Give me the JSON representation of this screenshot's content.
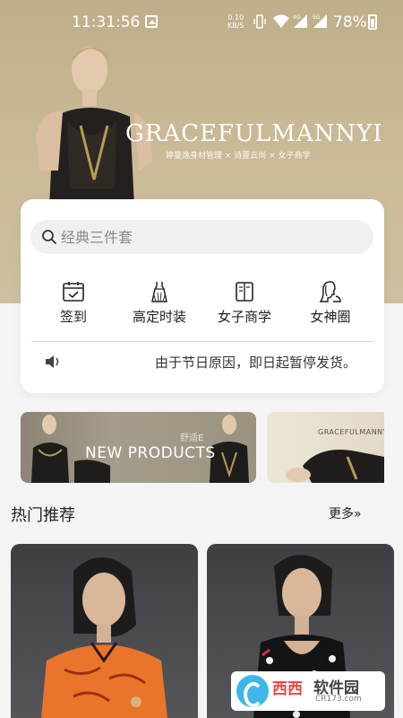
{
  "status_bar": {
    "time": "11:31:56",
    "net_speed_value": "0.10",
    "net_speed_unit": "KB/S",
    "sig1_label": "4G",
    "sig2_label": "5G",
    "battery": "78%"
  },
  "hero": {
    "brand": "GRACEFULMANNYI",
    "tagline": "婷曼逸身材管理 × 诗蔓云尚 × 女子商学"
  },
  "search": {
    "placeholder": "经典三件套"
  },
  "menu": [
    {
      "label": "签到",
      "icon": "calendar-check-icon"
    },
    {
      "label": "高定时装",
      "icon": "dress-icon"
    },
    {
      "label": "女子商学",
      "icon": "book-icon"
    },
    {
      "label": "女神圈",
      "icon": "woman-profile-icon"
    }
  ],
  "notice": {
    "text": "由于节日原因，即日起暂停发货。"
  },
  "banners": [
    {
      "title": "NEW PRODUCTS",
      "subtitle": "舒适E"
    },
    {
      "title": "GRACEFULMANNY"
    }
  ],
  "section": {
    "title": "热门推荐",
    "more": "更多»"
  },
  "watermark": {
    "brand": "西西",
    "title": "软件园",
    "url": "CR173.com"
  },
  "colors": {
    "hero_bg": "#c6b591",
    "accent_orange": "#e8752a",
    "watermark_red": "#e8463e"
  }
}
